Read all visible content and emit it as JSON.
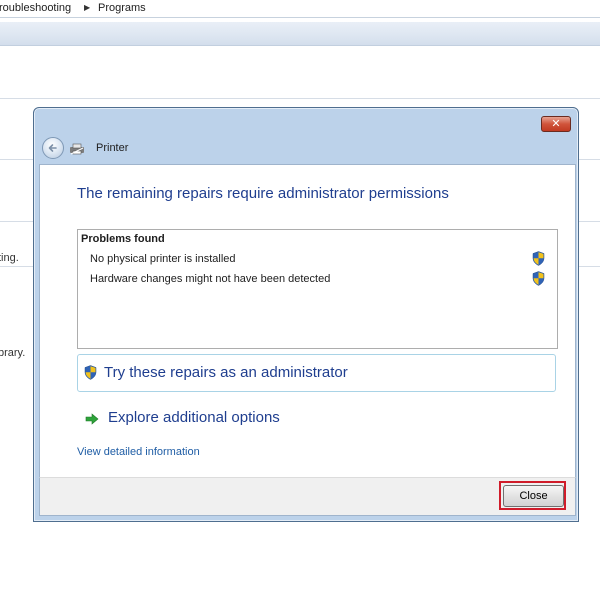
{
  "background": {
    "breadcrumb": [
      "roubleshooting",
      "Programs"
    ],
    "truncated_text_1": "ting.",
    "truncated_text_2": "brary."
  },
  "dialog": {
    "close_glyph": "✕",
    "nav_title": "Printer",
    "heading": "The remaining repairs require administrator permissions",
    "problems": {
      "title": "Problems found",
      "items": [
        {
          "text": "No physical printer is installed",
          "icon": "uac-shield-icon"
        },
        {
          "text": "Hardware changes might not have been detected",
          "icon": "uac-shield-icon"
        }
      ]
    },
    "commands": {
      "admin_repair": "Try these repairs as an administrator",
      "explore": "Explore additional options"
    },
    "detail_link": "View detailed information",
    "close_button": "Close"
  },
  "colors": {
    "heading_blue": "#1f3e8f",
    "link_blue": "#1f5da5",
    "highlight_red": "#d01c2a",
    "frame_blue": "#bcd2ea"
  }
}
